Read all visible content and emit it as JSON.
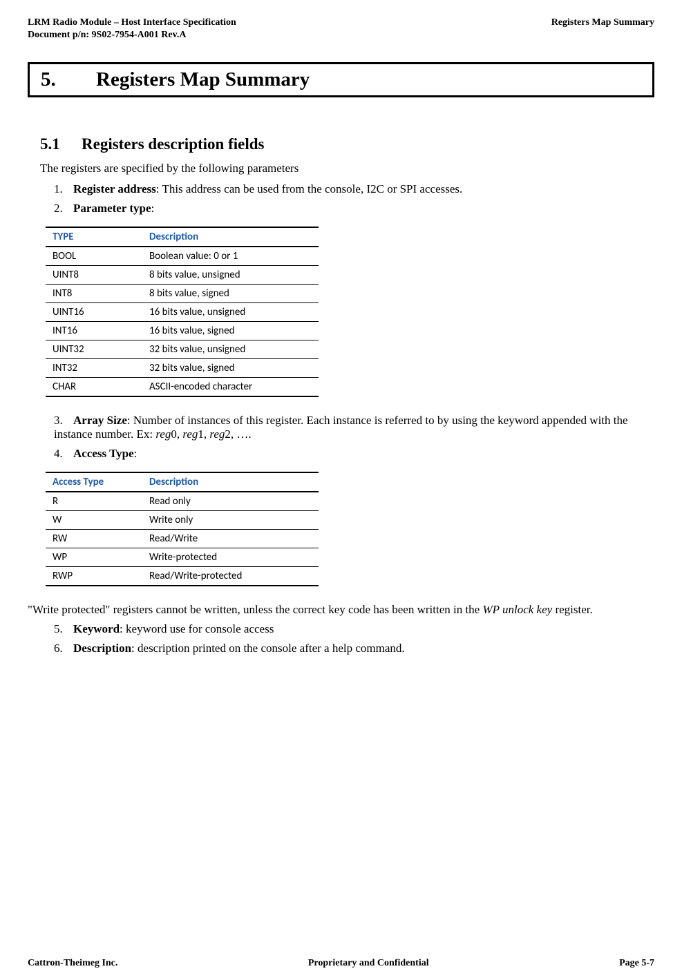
{
  "header": {
    "left_line1": "LRM Radio Module – Host Interface Specification",
    "left_line2": "Document p/n: 9S02-7954-A001 Rev.A",
    "right": "Registers Map Summary"
  },
  "title": {
    "num": "5.",
    "text": "Registers Map Summary"
  },
  "section": {
    "num": "5.1",
    "text": "Registers description fields"
  },
  "intro": "The registers are specified by the following parameters",
  "items": {
    "i1": {
      "num": "1.",
      "label": "Register address",
      "rest": ": This address can be used from the console, I2C or SPI accesses."
    },
    "i2": {
      "num": "2.",
      "label": "Parameter type",
      "rest": ":"
    },
    "i3": {
      "num": "3.",
      "label": "Array Size",
      "rest_a": ": Number of instances of this register.  Each instance is referred to by using the keyword appended with the instance number.  Ex: ",
      "ex0": "reg",
      "ex0n": "0, ",
      "ex1": "reg",
      "ex1n": "1, ",
      "ex2": "reg",
      "ex2n": "2, …."
    },
    "i4": {
      "num": "4.",
      "label": "Access Type",
      "rest": ":"
    },
    "i5": {
      "num": "5.",
      "label": "Keyword",
      "rest": ":  keyword use for console access"
    },
    "i6": {
      "num": "6.",
      "label": "Description",
      "rest": ": description printed on the console after a help command."
    }
  },
  "type_table": {
    "h1": "TYPE",
    "h2": "Description",
    "r": [
      {
        "c1": "BOOL",
        "c2": "Boolean value: 0 or 1"
      },
      {
        "c1": "UINT8",
        "c2": "8 bits value, unsigned"
      },
      {
        "c1": "INT8",
        "c2": "8 bits value, signed"
      },
      {
        "c1": "UINT16",
        "c2": "16 bits value, unsigned"
      },
      {
        "c1": "INT16",
        "c2": "16 bits value, signed"
      },
      {
        "c1": "UINT32",
        "c2": "32 bits value, unsigned"
      },
      {
        "c1": "INT32",
        "c2": "32 bits value, signed"
      },
      {
        "c1": "CHAR",
        "c2": "ASCII-encoded character"
      }
    ]
  },
  "access_table": {
    "h1": "Access Type",
    "h2": "Description",
    "r": [
      {
        "c1": "R",
        "c2": "Read only"
      },
      {
        "c1": "W",
        "c2": "Write only"
      },
      {
        "c1": "RW",
        "c2": "Read/Write"
      },
      {
        "c1": "WP",
        "c2": "Write-protected"
      },
      {
        "c1": "RWP",
        "c2": "Read/Write-protected"
      }
    ]
  },
  "wp_note": {
    "a": "\"Write protected\" registers cannot be written, unless the correct key code has been written in the ",
    "b": "WP unlock key",
    "c": " register."
  },
  "footer": {
    "left": "Cattron-Theimeg Inc.",
    "center": "Proprietary and Confidential",
    "right": "Page  5-7"
  }
}
